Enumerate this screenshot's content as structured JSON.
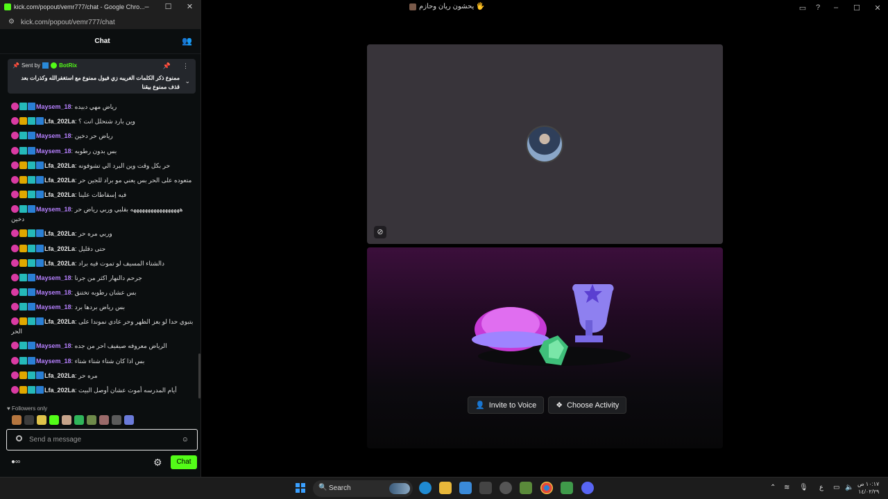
{
  "popout_window": {
    "title": "kick.com/popout/vemr777/chat - Google Chro...",
    "url": "kick.com/popout/vemr777/chat",
    "controls": [
      "–",
      "☐",
      "✕"
    ]
  },
  "chat": {
    "header": "Chat",
    "pinned": {
      "sent_by_label": "Sent by",
      "sender": "BotRix",
      "text": "ممنوع ذكر الكلمات الغريبه زي فيول ممنوع مع استغفرالله وكذرات بعد قذف ممنوع بيقنا"
    },
    "messages": [
      {
        "user": "Maysem_18",
        "color": "#b680ff",
        "badges": [
          "sub",
          "grid",
          "cube"
        ],
        "text": "رياض مهي دبيده"
      },
      {
        "user": "Lfa_202La",
        "color": "#e8e8e8",
        "badges": [
          "sub",
          "crown",
          "grid",
          "cube"
        ],
        "text": "وين بارد شتحلل انت ؟"
      },
      {
        "user": "Maysem_18",
        "color": "#b680ff",
        "badges": [
          "sub",
          "grid",
          "cube"
        ],
        "text": "رياض حر دخين"
      },
      {
        "user": "Maysem_18",
        "color": "#b680ff",
        "badges": [
          "sub",
          "grid",
          "cube"
        ],
        "text": "بس بدون رطوبه"
      },
      {
        "user": "Lfa_202La",
        "color": "#e8e8e8",
        "badges": [
          "sub",
          "crown",
          "grid",
          "cube"
        ],
        "text": "حر بكل وقت وين البرد الي تشوفونه"
      },
      {
        "user": "Lfa_202La",
        "color": "#e8e8e8",
        "badges": [
          "sub",
          "crown",
          "grid",
          "cube"
        ],
        "text": "متعوده على الحر بس يعني مو براد للجين حر"
      },
      {
        "user": "Lfa_202La",
        "color": "#e8e8e8",
        "badges": [
          "sub",
          "crown",
          "grid",
          "cube"
        ],
        "text": "فيه إسقاطات علينا"
      },
      {
        "user": "Maysem_18",
        "color": "#b680ff",
        "badges": [
          "sub",
          "grid",
          "cube"
        ],
        "text": "هههههههههههههههههه بقلبي وربي رياض حر دخين",
        "tall": true
      },
      {
        "user": "Lfa_202La",
        "color": "#e8e8e8",
        "badges": [
          "sub",
          "crown",
          "grid",
          "cube"
        ],
        "text": "وربي مره حر"
      },
      {
        "user": "Lfa_202La",
        "color": "#e8e8e8",
        "badges": [
          "sub",
          "crown",
          "grid",
          "cube"
        ],
        "text": "حتى دقليل"
      },
      {
        "user": "Lfa_202La",
        "color": "#e8e8e8",
        "badges": [
          "sub",
          "crown",
          "grid",
          "cube"
        ],
        "text": "دالشتاء المسيف لو تموت فيه براد"
      },
      {
        "user": "Maysem_18",
        "color": "#b680ff",
        "badges": [
          "sub",
          "grid",
          "cube"
        ],
        "text": "جرحم دالنهار اكثر من جرنا"
      },
      {
        "user": "Maysem_18",
        "color": "#b680ff",
        "badges": [
          "sub",
          "grid",
          "cube"
        ],
        "text": "بس عشان رطوبه تختنق"
      },
      {
        "user": "Maysem_18",
        "color": "#b680ff",
        "badges": [
          "sub",
          "grid",
          "cube"
        ],
        "text": "بس رياض بردها برد"
      },
      {
        "user": "Lfa_202La",
        "color": "#e8e8e8",
        "badges": [
          "sub",
          "crown",
          "grid",
          "cube"
        ],
        "text": "بتبوي حدا لو بعز الظهر وحر عادي نموندا على الحر",
        "tall": true
      },
      {
        "user": "Maysem_18",
        "color": "#b680ff",
        "badges": [
          "sub",
          "grid",
          "cube"
        ],
        "text": "الرياض معروفه صيفيف احر من جده"
      },
      {
        "user": "Maysem_18",
        "color": "#b680ff",
        "badges": [
          "sub",
          "grid",
          "cube"
        ],
        "text": "بس اذا كان شتاء شتاء شتاء"
      },
      {
        "user": "Lfa_202La",
        "color": "#e8e8e8",
        "badges": [
          "sub",
          "crown",
          "grid",
          "cube"
        ],
        "text": "مره حر"
      },
      {
        "user": "Lfa_202La",
        "color": "#e8e8e8",
        "badges": [
          "sub",
          "crown",
          "grid",
          "cube"
        ],
        "text": "أيام المدرسه أموت عشان أوصل البيت"
      }
    ],
    "followers_only": "Followers only",
    "input_placeholder": "Send a message",
    "chat_button": "Chat"
  },
  "main_window": {
    "title": "يحشون ريان وحازم 🖐️",
    "buttons": {
      "invite": "Invite to Voice",
      "activity": "Choose Activity"
    }
  },
  "taskbar": {
    "search": "Search",
    "lang": "ع",
    "time": "١٠:١٧ ص",
    "date": "١٤/٠٢/٢٩"
  },
  "colors": {
    "kick_green": "#53fc18",
    "username_purple": "#b680ff"
  }
}
